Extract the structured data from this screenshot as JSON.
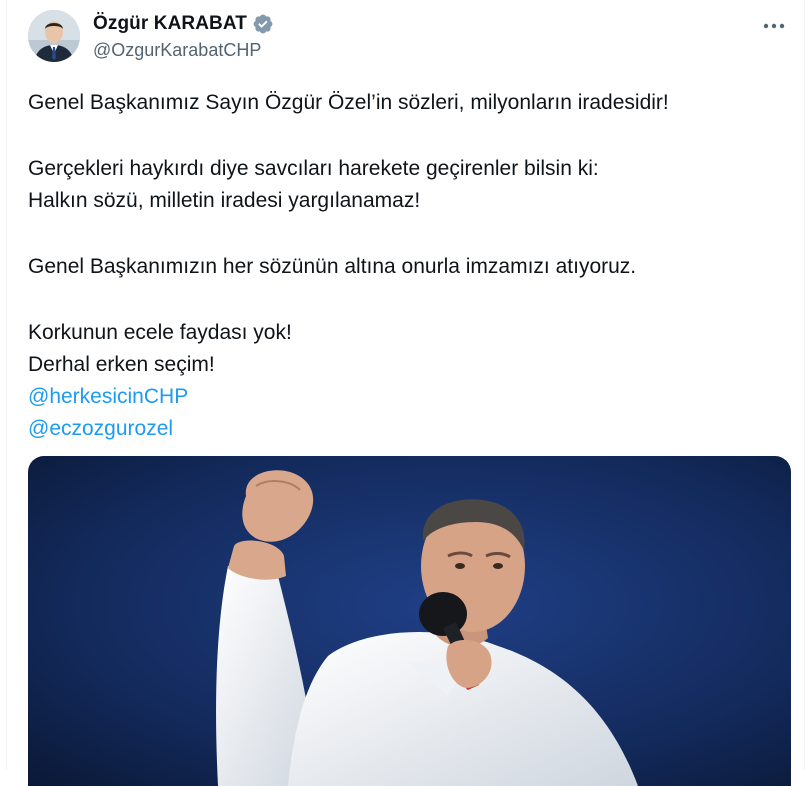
{
  "author": {
    "display_name": "Özgür KARABAT",
    "handle": "@OzgurKarabatCHP",
    "verified": true
  },
  "icons": {
    "verified": "verified-badge-icon",
    "more": "more-options-icon"
  },
  "colors": {
    "text": "#0f1419",
    "secondary": "#536471",
    "link": "#1d9bf0",
    "verified_badge": "#829aab"
  },
  "tweet": {
    "line1": "Genel Başkanımız Sayın Özgür Özel’in sözleri, milyonların iradesidir!",
    "line2": "Gerçekleri haykırdı diye savcıları harekete geçirenler bilsin ki:",
    "line3": "Halkın sözü, milletin iradesi yargılanamaz!",
    "line4": "Genel Başkanımızın her sözünün altına onurla imzamızı atıyoruz.",
    "line5": "Korkunun ecele faydası yok!",
    "line6": "Derhal erken seçim!",
    "mention1": "@herkesicinCHP",
    "mention2": "@eczozgurozel"
  }
}
